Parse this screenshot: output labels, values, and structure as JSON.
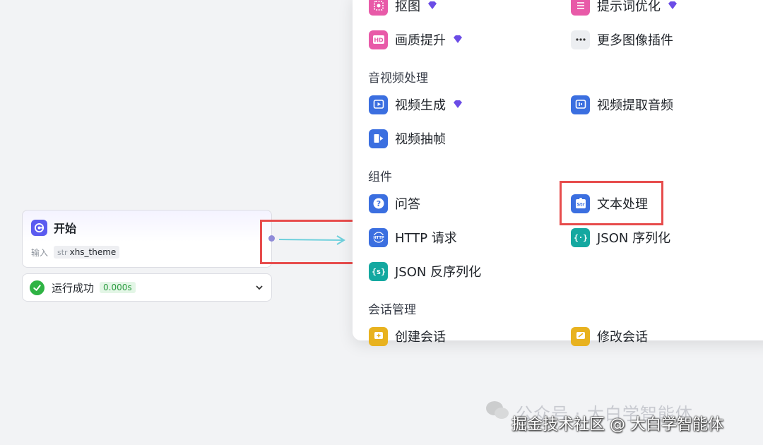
{
  "canvas": {
    "start_node": {
      "title": "开始",
      "input_label": "输入",
      "var_type": "str",
      "var_name": "xhs_theme"
    },
    "run_status": {
      "label": "运行成功",
      "time": "0.000s"
    }
  },
  "menu": {
    "items": {
      "cutout": {
        "label": "抠图",
        "icon": "cutout-icon",
        "premium": true
      },
      "prompt_opt": {
        "label": "提示词优化",
        "icon": "sliders-icon",
        "premium": true
      },
      "hd": {
        "label": "画质提升",
        "icon": "hd-icon",
        "premium": true
      },
      "more_image": {
        "label": "更多图像插件",
        "icon": "more-icon"
      },
      "video_gen": {
        "label": "视频生成",
        "icon": "video-play-icon",
        "premium": true
      },
      "video_audio": {
        "label": "视频提取音频",
        "icon": "video-audio-icon"
      },
      "video_frame": {
        "label": "视频抽帧",
        "icon": "video-frame-icon"
      },
      "qa": {
        "label": "问答",
        "icon": "question-icon"
      },
      "text_proc": {
        "label": "文本处理",
        "icon": "str-puzzle-icon"
      },
      "http": {
        "label": "HTTP 请求",
        "icon": "http-icon"
      },
      "json_ser": {
        "label": "JSON 序列化",
        "icon": "json-icon"
      },
      "json_de": {
        "label": "JSON 反序列化",
        "icon": "json-de-icon"
      },
      "create_conv": {
        "label": "创建会话",
        "icon": "chat-add-icon"
      },
      "edit_conv": {
        "label": "修改会话",
        "icon": "chat-edit-icon"
      }
    },
    "sections": {
      "av": "音视频处理",
      "components": "组件",
      "conversation": "会话管理"
    }
  },
  "watermark": {
    "line1": "公众号 · 大白学智能体",
    "line2": "掘金技术社区 @ 大白学智能体"
  },
  "colors": {
    "accent_purple": "#5b5bf0",
    "highlight_red": "#e74c4c",
    "success_green": "#2fb344",
    "connector_cyan": "#6fd0dc",
    "premium_gem": "#6b4ce6"
  }
}
